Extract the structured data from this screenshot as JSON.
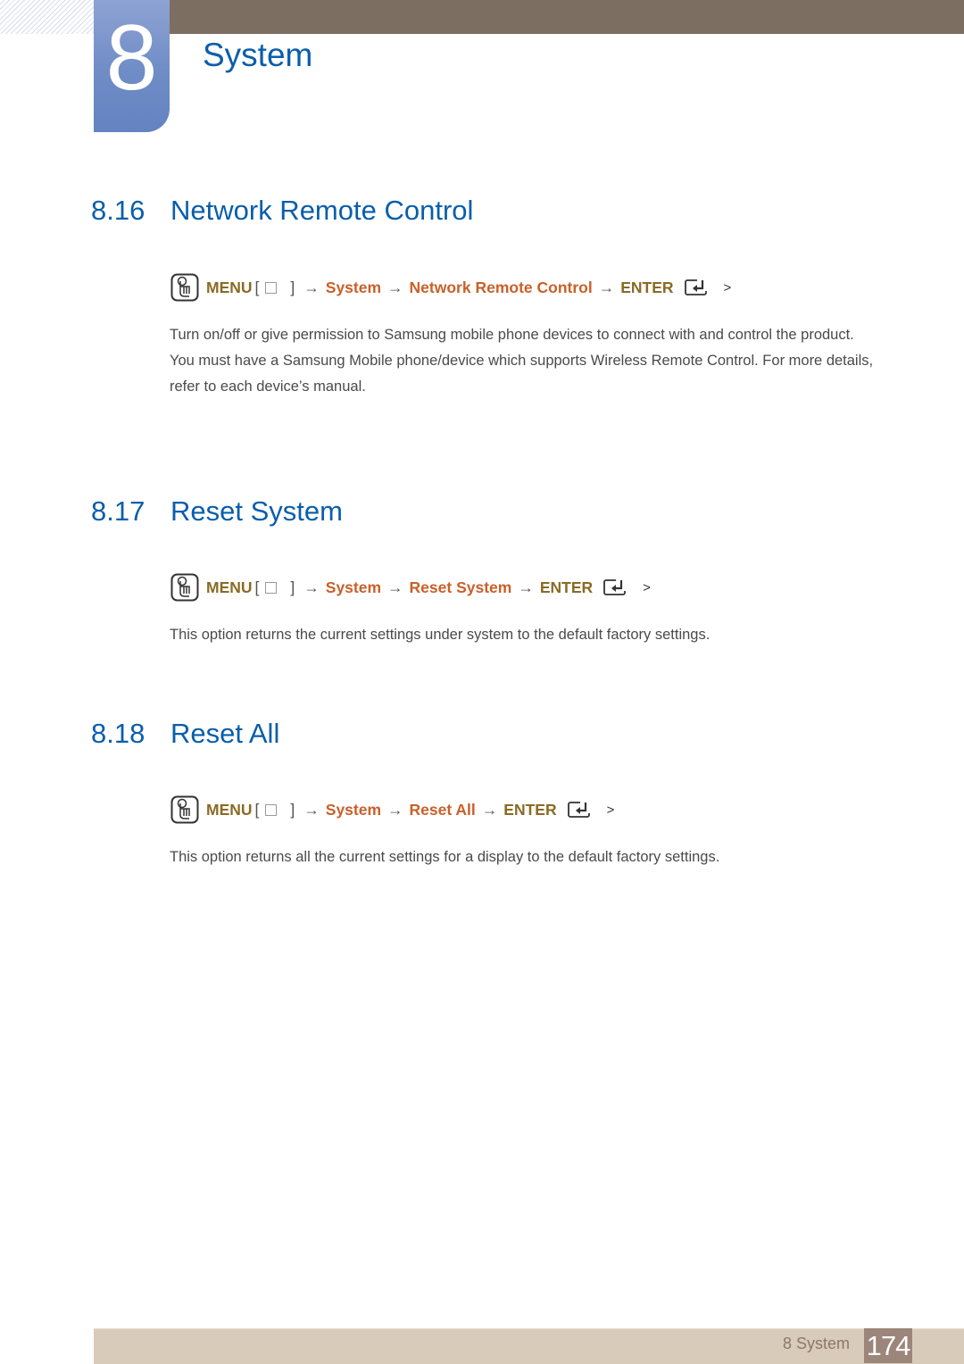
{
  "chapter": {
    "number": "8",
    "title": "System"
  },
  "colors": {
    "heading_blue": "#0a5eab",
    "menu_key": "#8a6a24",
    "path_item": "#c9602a",
    "top_bar": "#7d6e62",
    "footer_bar": "#d9cbb9",
    "page_badge": "#9c857a"
  },
  "sections": [
    {
      "number": "8.16",
      "title": "Network Remote Control",
      "menu_path": {
        "menu_label": "MENU",
        "bracket_open": "[",
        "bracket_close": "]",
        "arrow": "→",
        "items": [
          "System",
          "Network Remote Control"
        ],
        "enter_label": "ENTER",
        "trail": ">"
      },
      "paragraphs": [
        "Turn on/off or give permission to Samsung mobile phone devices to connect with and control the product.",
        "You must have a Samsung Mobile phone/device which supports Wireless Remote Control. For more details, refer to each device’s manual."
      ]
    },
    {
      "number": "8.17",
      "title": "Reset System",
      "menu_path": {
        "menu_label": "MENU",
        "bracket_open": "[",
        "bracket_close": "]",
        "arrow": "→",
        "items": [
          "System",
          "Reset System"
        ],
        "enter_label": "ENTER",
        "trail": ">"
      },
      "paragraphs": [
        "This option returns the current settings under system to the default factory settings."
      ]
    },
    {
      "number": "8.18",
      "title": "Reset All",
      "menu_path": {
        "menu_label": "MENU",
        "bracket_open": "[",
        "bracket_close": "]",
        "arrow": "→",
        "items": [
          "System",
          "Reset All"
        ],
        "enter_label": "ENTER",
        "trail": ">"
      },
      "paragraphs": [
        "This option returns all the current settings for a display to the default factory settings."
      ]
    }
  ],
  "footer": {
    "chapter_label": "8 System",
    "page_number": "174"
  }
}
